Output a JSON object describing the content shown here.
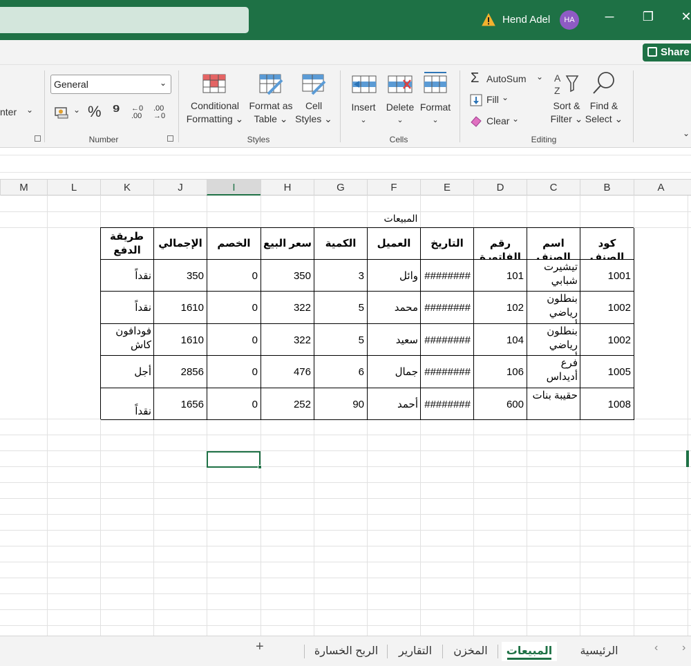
{
  "titlebar": {
    "user_name": "Hend Adel",
    "avatar_initials": "HA",
    "minimize": "─",
    "restore": "❐",
    "close": "✕"
  },
  "share": {
    "label": "Share"
  },
  "ribbon": {
    "alignment": {
      "merge_label": "nter"
    },
    "number": {
      "format_value": "General",
      "percent": "%",
      "comma": "⁹",
      "inc_decimal": "←0 .00",
      "dec_decimal": ".00 →0",
      "group_label": "Number"
    },
    "styles": {
      "conditional_formatting": [
        "Conditional",
        "Formatting ⌄"
      ],
      "format_as_table": [
        "Format as",
        "Table ⌄"
      ],
      "cell_styles": [
        "Cell",
        "Styles ⌄"
      ],
      "group_label": "Styles"
    },
    "cells": {
      "insert": "Insert",
      "delete": "Delete",
      "format": "Format",
      "group_label": "Cells"
    },
    "editing": {
      "autosum": "AutoSum",
      "fill": "Fill",
      "clear": "Clear",
      "sort_filter": [
        "Sort &",
        "Filter ⌄"
      ],
      "find_select": [
        "Find &",
        "Select ⌄"
      ],
      "group_label": "Editing"
    }
  },
  "columns": [
    "M",
    "L",
    "K",
    "J",
    "I",
    "H",
    "G",
    "F",
    "E",
    "D",
    "C",
    "B",
    "A"
  ],
  "sheet": {
    "title": "المبيعات",
    "headers": [
      "كود الصنف",
      "اسم الصنف",
      "رقم الفاتورة",
      "التاريخ",
      "العميل",
      "الكمية",
      "سعر البيع",
      "الخصم",
      "الإجمالي",
      "طريقة الدفع"
    ],
    "rows": [
      [
        "1001",
        "تيشيرت شبابي صيفي",
        "101",
        "########",
        "وائل",
        "3",
        "350",
        "0",
        "350",
        "نقداً"
      ],
      [
        "1002",
        "بنطلون رياضي أسود",
        "102",
        "########",
        "محمد",
        "5",
        "322",
        "0",
        "1610",
        "نقداً"
      ],
      [
        "1002",
        "بنطلون رياضي أسود",
        "104",
        "########",
        "سعيد",
        "5",
        "322",
        "0",
        "1610",
        "فودافون كاش"
      ],
      [
        "1005",
        "فرع أديداس",
        "106",
        "########",
        "جمال",
        "6",
        "476",
        "0",
        "2856",
        "أجل"
      ],
      [
        "1008",
        "حقيبة بنات",
        "600",
        "########",
        "أحمد",
        "90",
        "252",
        "0",
        "1656",
        "نقداً"
      ]
    ]
  },
  "tabs": {
    "add": "+",
    "items": [
      "الرئيسية",
      "المبيعات",
      "المخزن",
      "التقارير",
      "الربح  الخسارة"
    ],
    "active_index": 1
  }
}
